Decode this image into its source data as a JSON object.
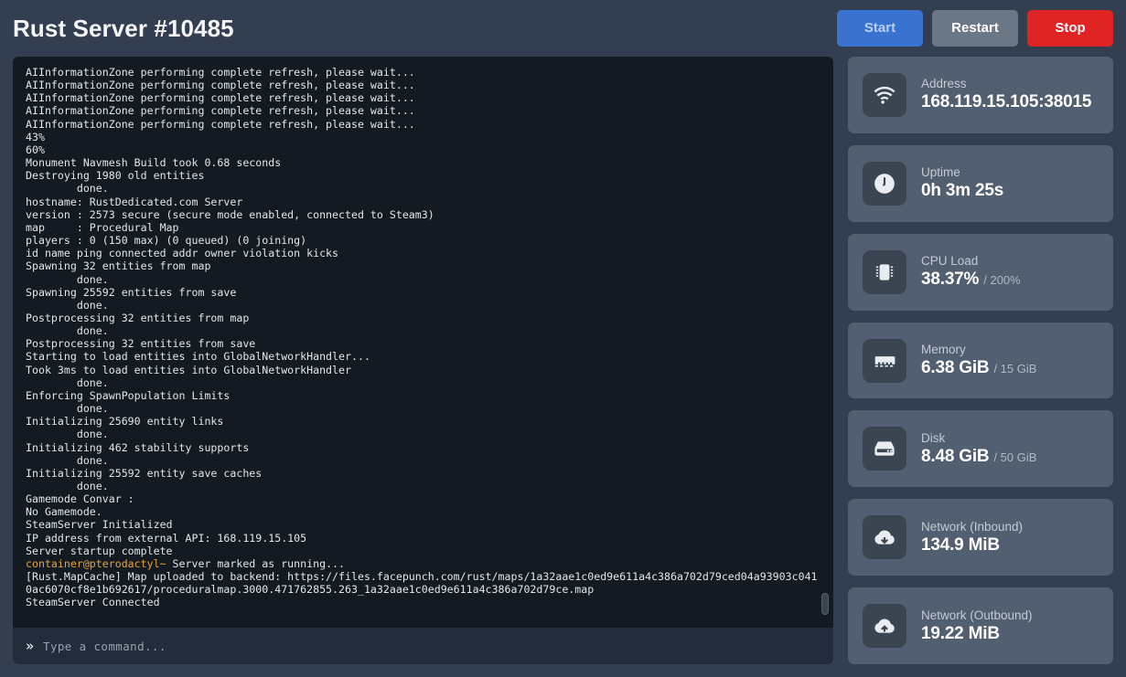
{
  "header": {
    "title": "Rust Server #10485",
    "buttons": [
      {
        "label": "Start",
        "name": "start-button",
        "color": "#3a72d0"
      },
      {
        "label": "Restart",
        "name": "restart-button",
        "color": "#6b7785"
      },
      {
        "label": "Stop",
        "name": "stop-button",
        "color": "#e02424"
      }
    ]
  },
  "console": {
    "lines": [
      {
        "text": "AIInformationZone performing complete refresh, please wait..."
      },
      {
        "text": "AIInformationZone performing complete refresh, please wait..."
      },
      {
        "text": "AIInformationZone performing complete refresh, please wait..."
      },
      {
        "text": "AIInformationZone performing complete refresh, please wait..."
      },
      {
        "text": "AIInformationZone performing complete refresh, please wait..."
      },
      {
        "text": "43%"
      },
      {
        "text": "60%"
      },
      {
        "text": "Monument Navmesh Build took 0.68 seconds"
      },
      {
        "text": "Destroying 1980 old entities"
      },
      {
        "text": "        done."
      },
      {
        "text": "hostname: RustDedicated.com Server"
      },
      {
        "text": "version : 2573 secure (secure mode enabled, connected to Steam3)"
      },
      {
        "text": "map     : Procedural Map"
      },
      {
        "text": "players : 0 (150 max) (0 queued) (0 joining)"
      },
      {
        "text": "id name ping connected addr owner violation kicks"
      },
      {
        "text": "Spawning 32 entities from map"
      },
      {
        "text": "        done."
      },
      {
        "text": "Spawning 25592 entities from save"
      },
      {
        "text": "        done."
      },
      {
        "text": "Postprocessing 32 entities from map"
      },
      {
        "text": "        done."
      },
      {
        "text": "Postprocessing 32 entities from save"
      },
      {
        "text": "Starting to load entities into GlobalNetworkHandler..."
      },
      {
        "text": "Took 3ms to load entities into GlobalNetworkHandler"
      },
      {
        "text": "        done."
      },
      {
        "text": "Enforcing SpawnPopulation Limits"
      },
      {
        "text": "        done."
      },
      {
        "text": "Initializing 25690 entity links"
      },
      {
        "text": "        done."
      },
      {
        "text": "Initializing 462 stability supports"
      },
      {
        "text": "        done."
      },
      {
        "text": "Initializing 25592 entity save caches"
      },
      {
        "text": "        done."
      },
      {
        "text": "Gamemode Convar :"
      },
      {
        "text": "No Gamemode."
      },
      {
        "text": "SteamServer Initialized"
      },
      {
        "text": "IP address from external API: 168.119.15.105"
      },
      {
        "text": "Server startup complete"
      },
      {
        "prompt": "container@pterodactyl~",
        "text": " Server marked as running..."
      },
      {
        "text": "[Rust.MapCache] Map uploaded to backend: https://files.facepunch.com/rust/maps/1a32aae1c0ed9e611a4c386a702d79ced04a93903c0410ac6070cf8e1b692617/proceduralmap.3000.471762855.263_1a32aae1c0ed9e611a4c386a702d79ce.map"
      },
      {
        "text": "SteamServer Connected"
      }
    ]
  },
  "command_bar": {
    "chevron": "»",
    "placeholder": "Type a command...",
    "value": ""
  },
  "stats": [
    {
      "icon": "wifi-icon",
      "label": "Address",
      "value": "168.119.15.105:38015",
      "sub": ""
    },
    {
      "icon": "clock-icon",
      "label": "Uptime",
      "value": "0h 3m 25s",
      "sub": ""
    },
    {
      "icon": "cpu-chip-icon",
      "label": "CPU Load",
      "value": "38.37%",
      "sub": "/ 200%"
    },
    {
      "icon": "memory-icon",
      "label": "Memory",
      "value": "6.38 GiB",
      "sub": "/ 15 GiB"
    },
    {
      "icon": "hard-drive-icon",
      "label": "Disk",
      "value": "8.48 GiB",
      "sub": "/ 50 GiB"
    },
    {
      "icon": "cloud-download-icon",
      "label": "Network (Inbound)",
      "value": "134.9 MiB",
      "sub": ""
    },
    {
      "icon": "cloud-upload-icon",
      "label": "Network (Outbound)",
      "value": "19.22 MiB",
      "sub": ""
    }
  ],
  "colors": {
    "page_background": "#333f51",
    "card_background": "#525f70",
    "icon_badge_background": "#3b4552",
    "console_background": "#131a22",
    "command_bar_background": "#222c3a",
    "prompt_accent": "#e8a33d",
    "start": "#3a72d0",
    "restart": "#6b7785",
    "stop": "#e02424"
  }
}
